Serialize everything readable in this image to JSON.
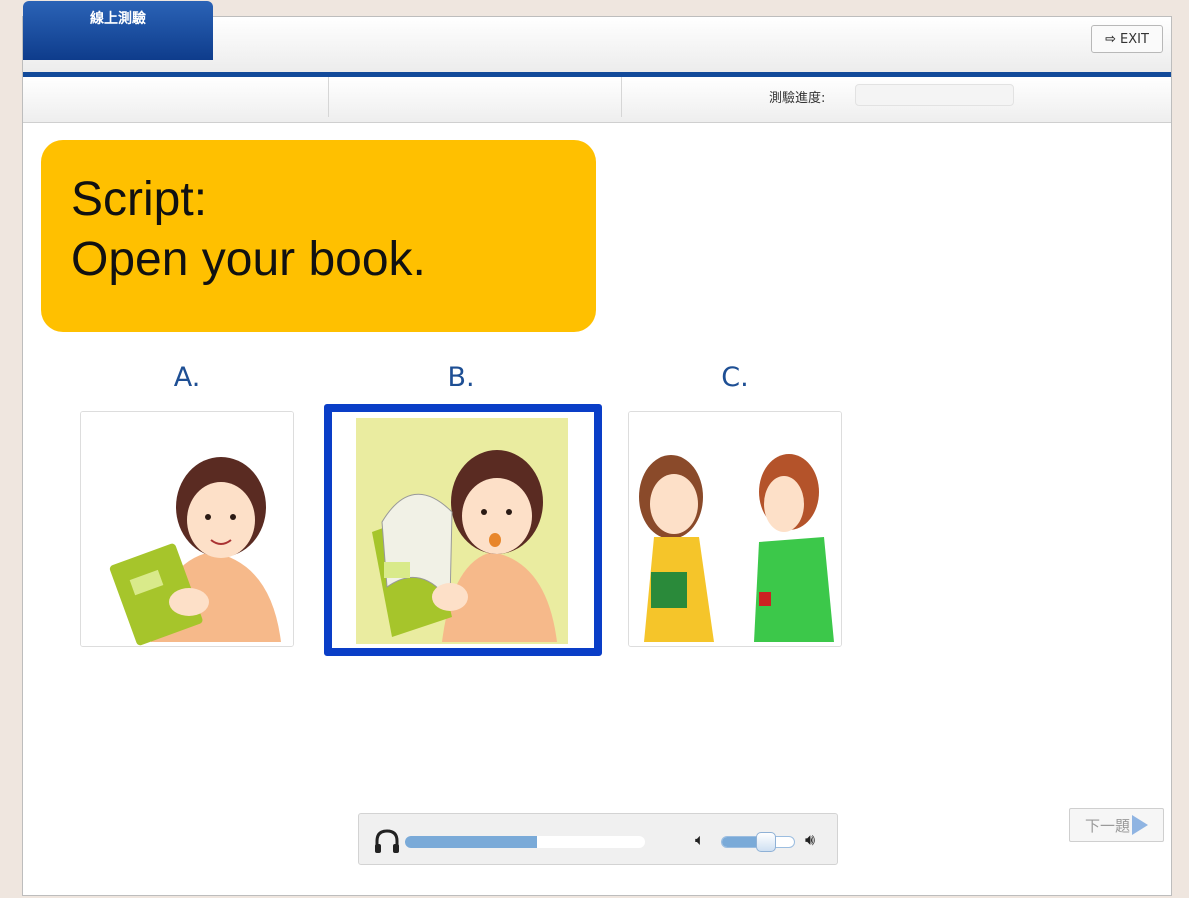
{
  "header": {
    "tab_label": "線上測驗",
    "exit_label": "EXIT"
  },
  "subbar": {
    "progress_label": "測驗進度:",
    "progress_value": ""
  },
  "script": {
    "line1": "Script:",
    "line2": "Open your book."
  },
  "options": [
    {
      "label": "A.",
      "image": "girl-holding-closed-book",
      "selected": false
    },
    {
      "label": "B.",
      "image": "girl-opening-book",
      "selected": true
    },
    {
      "label": "C.",
      "image": "two-girls-with-book",
      "selected": false
    }
  ],
  "player": {
    "playback_progress": 0.55,
    "volume_level": 0.55
  },
  "next_button": {
    "label": "下一題"
  },
  "colors": {
    "accent": "#124a9a",
    "script_bg": "#ffc000",
    "selection": "#0a3ec7",
    "option_label": "#1e4f94"
  }
}
